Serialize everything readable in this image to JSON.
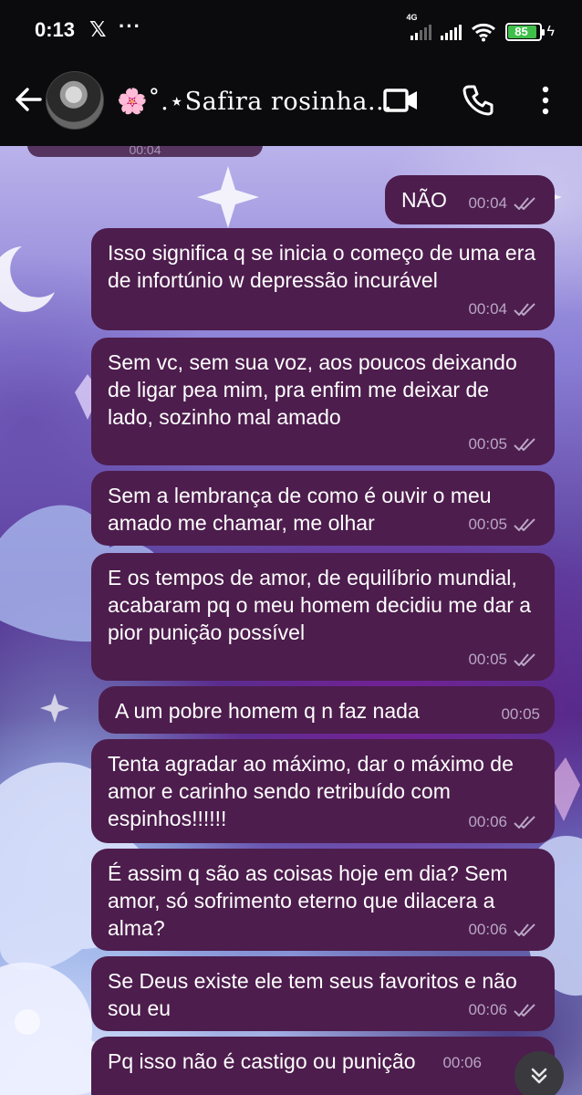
{
  "status_bar": {
    "time": "0:13",
    "x_app": "𝕏",
    "more": "···",
    "network_tag": "4G",
    "battery_level": "85",
    "battery_color": "#3fbf4a"
  },
  "header": {
    "title": "🌸˚.⋆Safira rosinha...",
    "icons": [
      "back-arrow-icon",
      "video-call-icon",
      "phone-icon",
      "more-vertical-icon"
    ]
  },
  "chat": {
    "top_pill_time": "00:04",
    "bubble_color": "#4d1d4d",
    "messages": [
      {
        "text": "NÃO",
        "time": "00:04"
      },
      {
        "text": "Isso significa q se inicia o começo de uma era de infortúnio w depressão incurável",
        "time": "00:04"
      },
      {
        "text": "Sem vc, sem sua voz, aos poucos deixando de ligar pea mim, pra enfim me deixar de lado, sozinho mal amado",
        "time": "00:05"
      },
      {
        "text": "Sem a lembrança de como é ouvir o meu amado me chamar, me olhar",
        "time": "00:05"
      },
      {
        "text": "E os tempos de amor, de equilíbrio mundial, acabaram pq o meu homem decidiu me dar a pior punição possível",
        "time": "00:05"
      },
      {
        "text": "A um pobre homem q n faz nada",
        "time": "00:05"
      },
      {
        "text": "Tenta agradar ao máximo, dar o máximo de amor e carinho sendo retribuído com espinhos!!!!!!",
        "time": "00:06"
      },
      {
        "text": "É assim q são as coisas hoje em dia? Sem amor, só sofrimento eterno que dilacera a alma?",
        "time": "00:06"
      },
      {
        "text": "Se Deus existe ele tem seus favoritos e não sou eu",
        "time": "00:06"
      },
      {
        "text": "Pq isso não é castigo ou punição",
        "time": "00:06"
      }
    ]
  }
}
